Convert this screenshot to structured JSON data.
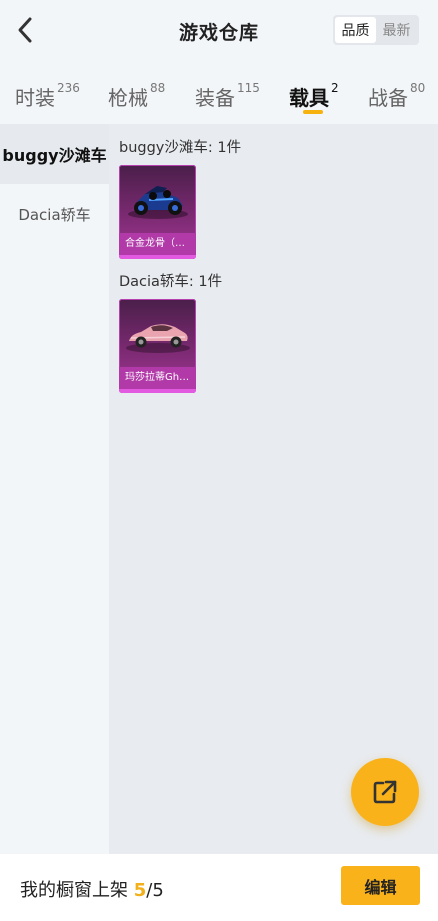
{
  "header": {
    "title": "游戏仓库",
    "sort_options": [
      "品质",
      "最新"
    ],
    "sort_selected": "品质"
  },
  "tabs": [
    {
      "label": "时装",
      "count": "236"
    },
    {
      "label": "枪械",
      "count": "88"
    },
    {
      "label": "装备",
      "count": "115"
    },
    {
      "label": "载具",
      "count": "2",
      "active": true
    },
    {
      "label": "战备",
      "count": "80"
    }
  ],
  "sidebar": {
    "items": [
      {
        "label": "buggy沙滩车",
        "active": true
      },
      {
        "label": "Dacia轿车",
        "active": false
      }
    ]
  },
  "groups": [
    {
      "title": "buggy沙滩车: 1件",
      "items": [
        {
          "name": "合金龙骨（蓝..."
        }
      ]
    },
    {
      "title": "Dacia轿车: 1件",
      "items": [
        {
          "name": "玛莎拉蒂Ghi..."
        }
      ]
    }
  ],
  "bottom": {
    "shelf_label": "我的橱窗上架 ",
    "shelf_count": "5",
    "shelf_total": "/5",
    "edit_label": "编辑"
  },
  "colors": {
    "accent": "#f9b21a",
    "card_purple": "#b13aa8"
  },
  "icons": {
    "back": "chevron-left-icon",
    "share": "share-external-icon"
  }
}
